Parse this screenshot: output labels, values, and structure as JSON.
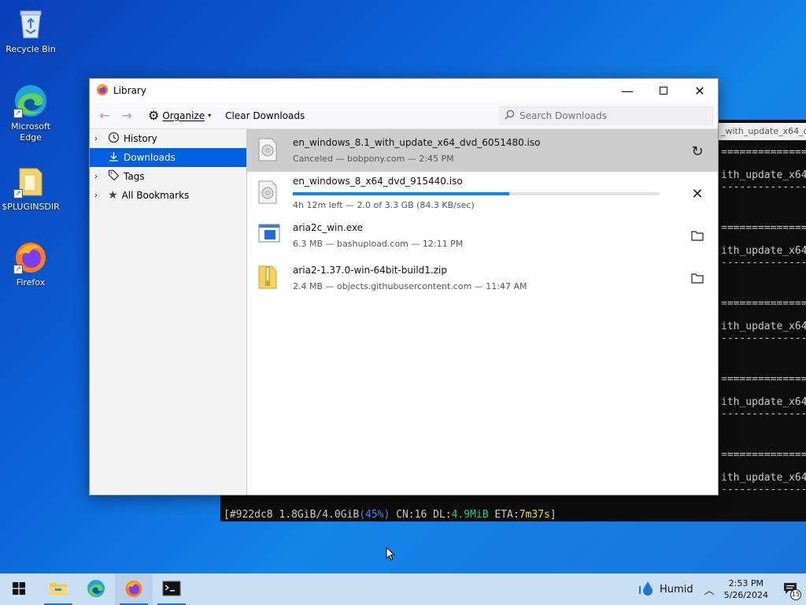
{
  "desktop": {
    "icons": [
      {
        "label": "Recycle Bin"
      },
      {
        "label": "Microsoft Edge"
      },
      {
        "label": "$PLUGINSDIR"
      },
      {
        "label": "Firefox"
      }
    ]
  },
  "terminal": {
    "title_fragment": "_with_update_x64_d",
    "lines": [
      "================",
      "ith_update_x64_",
      "----------------",
      "================",
      "ith_update_x64_",
      "----------------",
      "================",
      "ith_update_x64_",
      "----------------",
      "================",
      "ith_update_x64_",
      "----------------",
      "================",
      "ith_update_x64_",
      "----------------"
    ],
    "status": {
      "prefix": "[#922dc8 1.8GiB/4.0GiB",
      "percent": "(45%)",
      "cn": " CN:16 DL:",
      "dl": "4.9MiB",
      "eta_label": " ETA:",
      "eta": "7m37s",
      "suffix": "]"
    }
  },
  "library": {
    "title": "Library",
    "toolbar": {
      "organize_label": "Organize",
      "clear_label": "Clear Downloads",
      "search_placeholder": "Search Downloads"
    },
    "sidebar": [
      {
        "label": "History",
        "icon": "clock-icon",
        "expandable": true,
        "selected": false
      },
      {
        "label": "Downloads",
        "icon": "download-icon",
        "expandable": false,
        "selected": true
      },
      {
        "label": "Tags",
        "icon": "tag-icon",
        "expandable": true,
        "selected": false
      },
      {
        "label": "All Bookmarks",
        "icon": "star-icon",
        "expandable": true,
        "selected": false
      }
    ],
    "downloads": [
      {
        "name": "en_windows_8.1_with_update_x64_dvd_6051480.iso",
        "status": "Canceled — bobpony.com — 2:45 PM",
        "icon": "disc-file-icon",
        "action": "retry-icon",
        "selected": true
      },
      {
        "name": "en_windows_8_x64_dvd_915440.iso",
        "status": "4h 12m left — 2.0 of 3.3 GB (84.3 KB/sec)",
        "icon": "disc-file-icon",
        "action": "cancel-icon",
        "progress_percent": 59
      },
      {
        "name": "aria2c_win.exe",
        "status": "6.3 MB — bashupload.com — 12:11 PM",
        "icon": "exe-file-icon",
        "action": "folder-icon"
      },
      {
        "name": "aria2-1.37.0-win-64bit-build1.zip",
        "status": "2.4 MB — objects.githubusercontent.com — 11:47 AM",
        "icon": "zip-file-icon",
        "action": "folder-icon"
      }
    ]
  },
  "taskbar": {
    "weather_label": "Humid",
    "time": "2:53 PM",
    "date": "5/26/2024",
    "notification_count": "15"
  },
  "colors": {
    "accent": "#0060df",
    "progress": "#0a84ff",
    "taskbar": "#c9dff4"
  }
}
